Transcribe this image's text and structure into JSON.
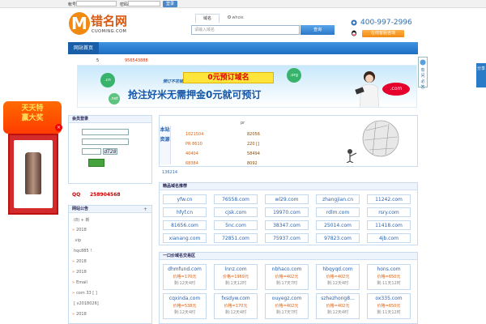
{
  "topbar": {
    "user_label": "帐号",
    "pass_label": "密码",
    "login_button": "登录"
  },
  "header": {
    "logo_text": "错名网",
    "logo_sub": "CUOMING.COM",
    "search_tab_active": "域名",
    "search_tab_other": "whois",
    "search_placeholder": "请输入域名",
    "search_button": "查询",
    "phone": "400-997-2996",
    "service_button": "在线客服咨询"
  },
  "nav": {
    "home": "网站首页"
  },
  "ticker": {
    "prefix": "5",
    "number": "956543888"
  },
  "banner": {
    "bubble_cn": ".cn",
    "bubble_org": ".org",
    "bubble_net": ".net",
    "promo_small": "预订不花钱",
    "headline": "0元预订域名",
    "subline": "抢注好米无需押金0元就可预订",
    "com_tag": ".com"
  },
  "side_ad": {
    "title_line1": "天天特",
    "title_line2": "赢大奖"
  },
  "ask": {
    "label": "有问必答"
  },
  "share": {
    "label": "分享"
  },
  "login_box": {
    "title": "会员登录",
    "captcha": "dT28"
  },
  "qq_line": {
    "label": "QQ",
    "number": "258904568"
  },
  "list_box": {
    "title": "网站公告",
    "more": "+",
    "items": [
      {
        "pre": "",
        "text": "(8) + 新"
      },
      {
        "pre": "»",
        "text": "2018"
      },
      {
        "pre": "",
        "text": ".vip"
      },
      {
        "pre": "",
        "text": "hqc885 !"
      },
      {
        "pre": "»",
        "text": "2018"
      },
      {
        "pre": "»",
        "text": "2018"
      },
      {
        "pre": "»",
        "text": "Email"
      },
      {
        "pre": "»",
        "text": "com    33 [ ]"
      },
      {
        "pre": "",
        "text": "[ v2018026]"
      },
      {
        "pre": "»",
        "text": "2018"
      }
    ]
  },
  "stats": {
    "label": "本站资源",
    "header_text": "pr",
    "rows": [
      [
        "1021504",
        "82056"
      ],
      [
        "PR 8610",
        "220 []"
      ],
      [
        "40404",
        "58494"
      ],
      [
        "68384",
        "8092"
      ]
    ],
    "id_line": "136214"
  },
  "grid1": {
    "title": "精品域名推荐",
    "domains": [
      "yfw.cn",
      "76558.com",
      "wl29.com",
      "zhangjian.cn",
      "11242.com",
      "hfyf.cn",
      "cjsk.com",
      "19970.com",
      "rdlm.com",
      "rsry.com",
      "81656.com",
      "5nc.com",
      "38347.com",
      "25014.com",
      "11418.com",
      "xianang.com",
      "72851.com",
      "75937.com",
      "97823.com",
      "4jb.com"
    ]
  },
  "grid2": {
    "title": "一口价域名交易区",
    "cells": [
      {
        "name": "dhmfund.com",
        "price": "价格=170元",
        "time": "剩:12天4时"
      },
      {
        "name": "lnnz.com",
        "price": "价格=1969元",
        "time": "剩:1天12时"
      },
      {
        "name": "nbhaco.com",
        "price": "价格=402元",
        "time": "剩:17天7时"
      },
      {
        "name": "hbqyqd.com",
        "price": "价格=402元",
        "time": "剩:12天4时"
      },
      {
        "name": "hons.com",
        "price": "价格=650元",
        "time": "剩:11天12时"
      },
      {
        "name": "cqxinda.com",
        "price": "价格=538元",
        "time": "剩:12天4时"
      },
      {
        "name": "fxsdyw.com",
        "price": "价格=170元",
        "time": "剩:12天4时"
      },
      {
        "name": "ouyegz.com",
        "price": "价格=402元",
        "time": "剩:17天7时"
      },
      {
        "name": "szhezhong8...",
        "price": "价格=402元",
        "time": "剩:12天4时"
      },
      {
        "name": "ox335.com",
        "price": "价格=650元",
        "time": "剩:11天12时"
      }
    ]
  },
  "colors": {
    "brand_blue": "#1d6ec3",
    "accent_orange": "#f08a10",
    "link_blue": "#2a62b0"
  }
}
